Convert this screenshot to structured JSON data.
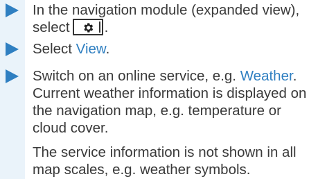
{
  "instructions": {
    "step1_before": "In the navigation module (expanded view),",
    "step1_line2_prefix": "select",
    "step1_after": ".",
    "step1_icon": "gear-icon",
    "step2_prefix": "Select ",
    "step2_link": "View",
    "step2_suffix": ".",
    "step3_prefix": "Switch on an online service, e.g. ",
    "step3_link": "Weather",
    "step3_suffix": ".",
    "result": "Current weather information is displayed on the navigation map, e.g. temperature or cloud cover.",
    "note": "The service information is not shown in all map scales, e.g. weather symbols."
  },
  "colors": {
    "accent": "#2f7fc1",
    "sidebar": "#eaf3fa",
    "text": "#3a3a3a"
  }
}
